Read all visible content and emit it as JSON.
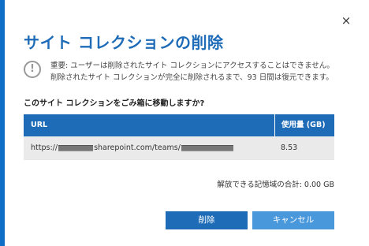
{
  "dialog": {
    "title": "サイト コレクションの削除",
    "close_glyph": "×",
    "warning_glyph": "!",
    "notice": "重要: ユーザーは削除されたサイト コレクションにアクセスすることはできません。削除されたサイト コレクションが完全に削除されるまで、93 日間は復元できます。",
    "question": "このサイト コレクションをごみ箱に移動しますか?"
  },
  "table": {
    "headers": {
      "url": "URL",
      "size": "使用量 (GB)"
    },
    "rows": [
      {
        "url_prefix": "https://",
        "url_middle": "sharepoint.com/teams/",
        "size": "8.53"
      }
    ]
  },
  "summary": {
    "total": "解放できる記憶域の合計: 0.00 GB"
  },
  "buttons": {
    "delete": "削除",
    "cancel": "キャンセル"
  },
  "colors": {
    "accent": "#1e6cb8",
    "accent_light": "#4a98dc",
    "row_background": "#eaeaea"
  },
  "icons": {
    "close": "close-icon",
    "warning": "warning-icon"
  }
}
